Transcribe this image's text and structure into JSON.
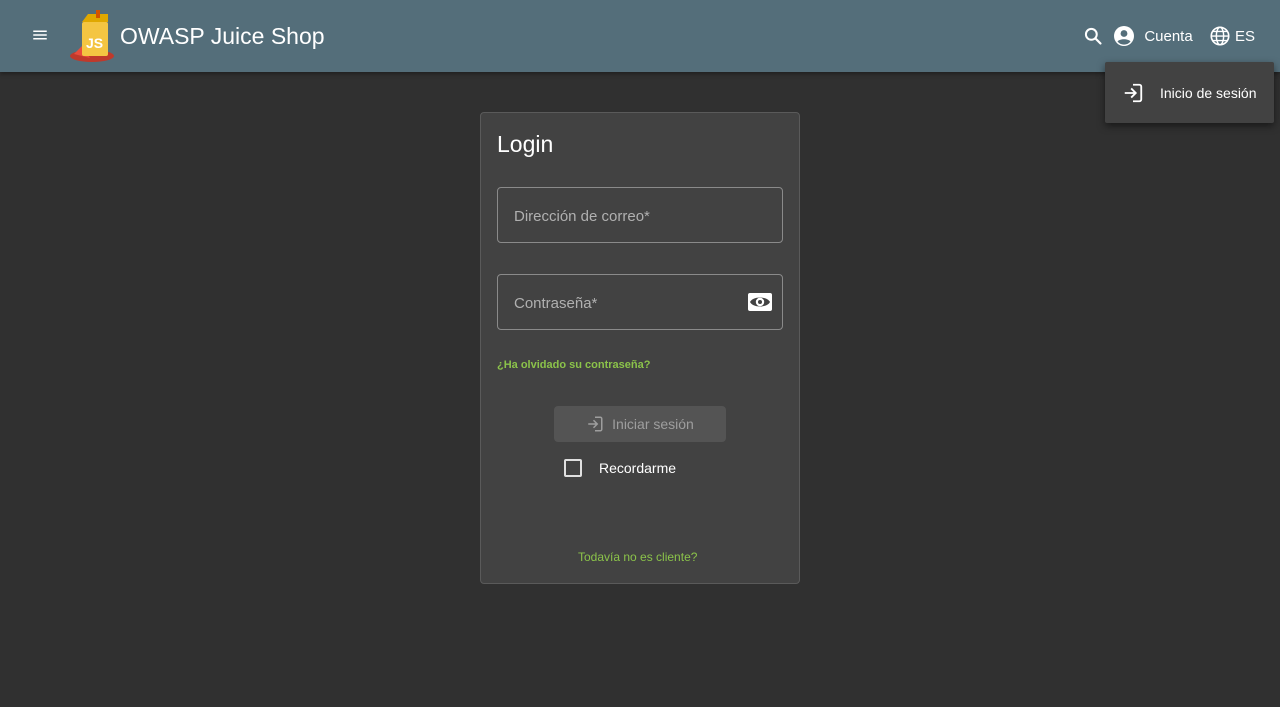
{
  "toolbar": {
    "app_title": "OWASP Juice Shop",
    "account_label": "Cuenta",
    "language_label": "ES",
    "icons": {
      "menu": "menu-icon",
      "logo": "juice-shop-logo",
      "search": "search-icon",
      "account": "account-circle-icon",
      "language": "language-globe-icon"
    }
  },
  "account_menu": {
    "items": [
      {
        "label": "Inicio de sesión",
        "icon": "login-icon"
      }
    ]
  },
  "login": {
    "title": "Login",
    "email_label": "Dirección de correo*",
    "email_value": "",
    "password_label": "Contraseña*",
    "password_value": "",
    "forgot_password": "¿Ha olvidado su contraseña?",
    "submit_label": "Iniciar sesión",
    "submit_disabled": true,
    "remember_me": "Recordarme",
    "remember_checked": false,
    "not_customer": "Todavía no es cliente?"
  },
  "colors": {
    "toolbar": "#546e7a",
    "background": "#303030",
    "card": "#424242",
    "accent_link": "#8bc34a"
  }
}
